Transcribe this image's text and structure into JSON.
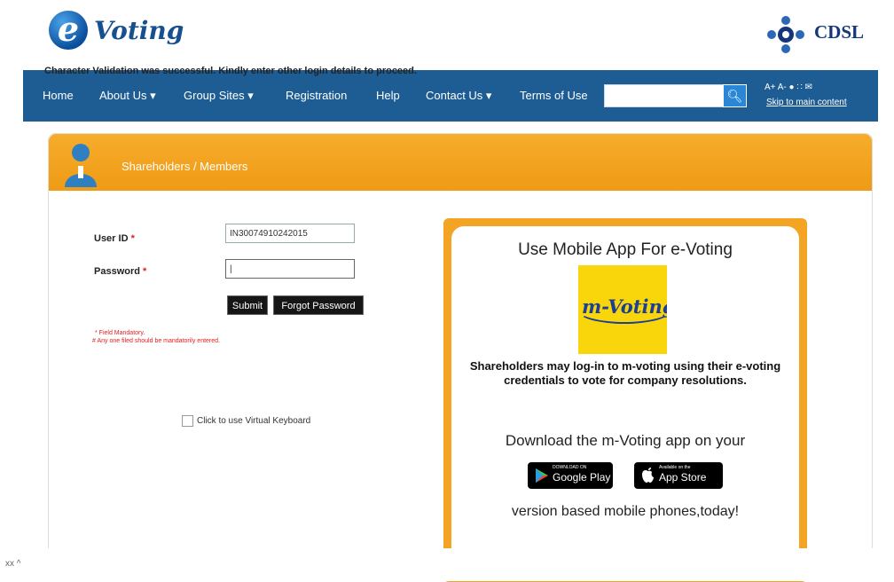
{
  "header": {
    "logo_letter": "e",
    "logo_text": "Voting",
    "partner": "CDSL"
  },
  "nav": {
    "items": [
      "Home",
      "About Us ▾",
      "Group Sites ▾",
      "Registration",
      "Help",
      "Contact Us ▾",
      "Terms of Use"
    ],
    "search_placeholder": "",
    "search_icon": "search-icon",
    "accessibility": "A+  A-  ●  ∷  ✉",
    "skip_link": "Skip to main content"
  },
  "panel": {
    "title": "Shareholders / Members",
    "message": "Character Validation was successful. Kindly enter other login details to proceed.",
    "userid_label": "User ID",
    "userid_value": "IN30074910242015",
    "password_label": "Password",
    "required_mark": "*",
    "submit_label": "Submit",
    "forgot_label": "Forgot Password",
    "note1": "* Field Mandatory.",
    "note2": "# Any one filed should be mandatorily entered.",
    "virtual_keyboard": "Click to use Virtual Keyboard"
  },
  "app_promo": {
    "title": "Use Mobile App For e-Voting",
    "logo_text": "m-Voting",
    "description": "Shareholders may log-in to m-voting using their e-voting credentials to vote for company resolutions.",
    "download_text": "Download the m-Voting app on your",
    "google_small": "DOWNLOAD ON",
    "google_big": "Google Play",
    "apple_small": "Available on the",
    "apple_big": "App Store",
    "version_text": "version based mobile phones,today!"
  },
  "footer": {
    "text": "xx  ^"
  },
  "colors": {
    "nav": "#1d5d94",
    "orange": "#f4a423",
    "brand_blue": "#16508f"
  }
}
